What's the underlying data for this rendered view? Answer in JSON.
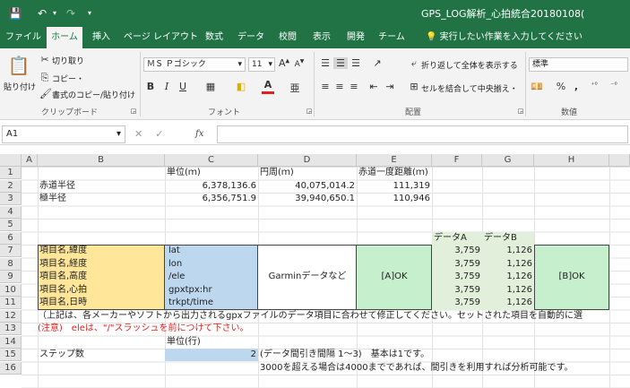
{
  "quick_access": {
    "save_icon": "💾",
    "undo_icon": "↶",
    "redo_icon": "↷",
    "customize_icon": "▾"
  },
  "window": {
    "title": "GPS_LOG解析_心拍統合20180108("
  },
  "tabs": [
    "ファイル",
    "ホーム",
    "挿入",
    "ページ レイアウト",
    "数式",
    "データ",
    "校閲",
    "表示",
    "開発",
    "チーム"
  ],
  "tell_me": "実行したい作業を入力してください",
  "ribbon": {
    "clipboard": {
      "paste": "貼り付け",
      "cut": "切り取り",
      "copy": "コピー・",
      "format_painter": "書式のコピー/貼り付け",
      "label": "クリップボード"
    },
    "font": {
      "name": "ＭＳ Ｐゴシック",
      "size": "11",
      "bold": "B",
      "italic": "I",
      "underline": "U",
      "font_color_letter": "A",
      "label": "フォント"
    },
    "alignment": {
      "wrap": "折り返して全体を表示する",
      "merge": "セルを結合して中央揃え・",
      "label": "配置"
    },
    "number": {
      "format": "標準",
      "percent": "%",
      "comma": ",",
      "label": "数値"
    }
  },
  "formula_bar": {
    "name_box": "A1",
    "fx": "fx",
    "cancel": "✕",
    "enter": "✓"
  },
  "columns": [
    "A",
    "B",
    "C",
    "D",
    "E",
    "F",
    "G",
    "H"
  ],
  "rows": [
    "1",
    "2",
    "3",
    "4",
    "5",
    "6",
    "7",
    "8",
    "9",
    "10",
    "11",
    "12",
    "13",
    "14",
    "15",
    "16"
  ],
  "cells": {
    "c1": "単位(ｍ)",
    "d1": "円周(ｍ)",
    "e1": "赤道一度距離(ｍ)",
    "b2": "赤道半径",
    "c2": "6,378,136.6",
    "d2": "40,075,014.2",
    "e2": "111,319",
    "b3": "極半径",
    "c3": "6,356,751.9",
    "d3": "39,940,650.1",
    "e3": "110,946",
    "f6": "データA",
    "g6": "データB",
    "b7": "項目名,緯度",
    "c7": "lat",
    "f7": "3,759",
    "g7": "1,126",
    "b8": "項目名,経度",
    "c8": "lon",
    "f8": "3,759",
    "g8": "1,126",
    "b9": "項目名,高度",
    "c9": "/ele",
    "d9": "Garminデータなど",
    "e9": "[A]OK",
    "f9": "3,759",
    "g9": "1,126",
    "h9": "[B]OK",
    "b10": "項目名,心拍",
    "c10": "gpxtpx:hr",
    "f10": "3,759",
    "g10": "1,126",
    "b11": "項目名,日時",
    "c11": "trkpt/time",
    "f11": "3,759",
    "g11": "1,126",
    "b12": "（上記は、各メーカーやソフトから出力されるgpxファイルのデータ項目に合わせて修正してください。セットされた項目を自動的に選",
    "b13": "(注意)　eleは、\"/\"スラッシュを前につけて下さい。",
    "c14": "単位(行)",
    "b15": "ステップ数",
    "c15": "2",
    "d15": "(データ間引き間隔 1～3)　基本は1です。",
    "d16": "3000を超える場合は4000までであれば、間引きを利用すれば分析可能です。"
  },
  "colors": {
    "excel_green": "#217346",
    "item_fill": "#ffe699",
    "value_fill": "#bdd7ee",
    "ok_fill": "#c6efce",
    "data_fill": "#e2efda",
    "note_red": "#e0201e"
  }
}
